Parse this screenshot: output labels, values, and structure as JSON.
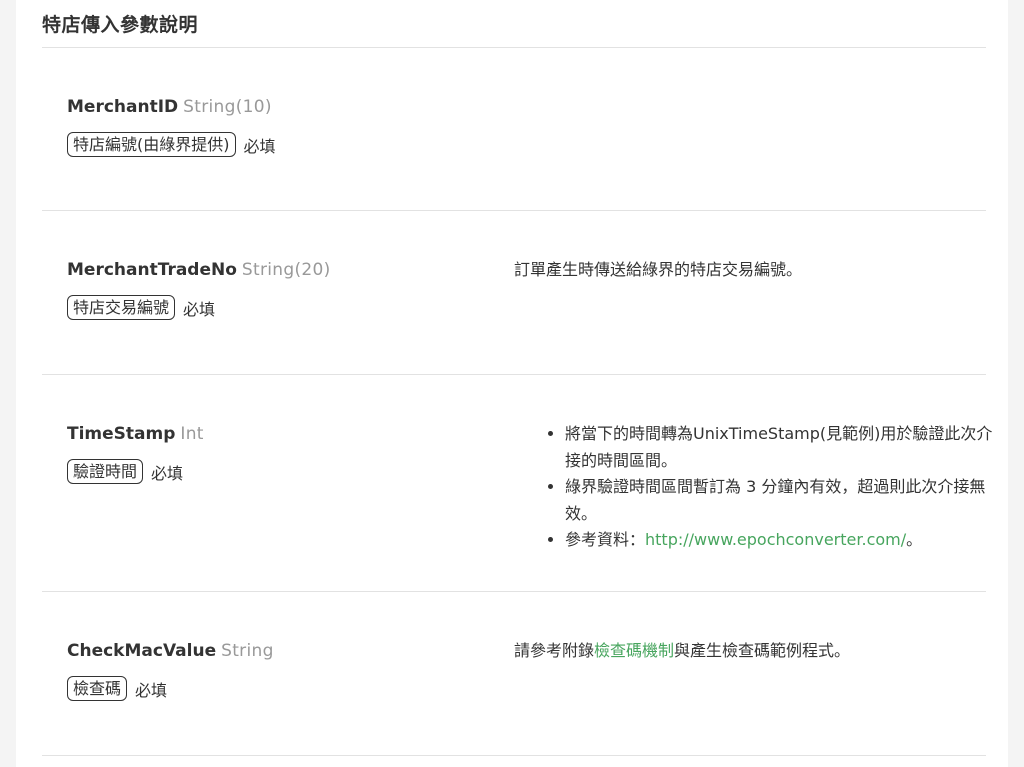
{
  "section": {
    "title": "特店傳入參數說明"
  },
  "params": [
    {
      "name": "MerchantID",
      "type": "String(10)",
      "tag": "特店編號(由綠界提供)",
      "required": "必填"
    },
    {
      "name": "MerchantTradeNo",
      "type": "String(20)",
      "tag": "特店交易編號",
      "required": "必填",
      "description": "訂單產生時傳送給綠界的特店交易編號。"
    },
    {
      "name": "TimeStamp",
      "type": "Int",
      "tag": "驗證時間",
      "required": "必填",
      "bullets": [
        "將當下的時間轉為UnixTimeStamp(見範例)用於驗證此次介接的時間區間。",
        "綠界驗證時間區間暫訂為 3 分鐘內有效，超過則此次介接無效。"
      ],
      "reference": {
        "label": "參考資料：",
        "link": "http://www.epochconverter.com/",
        "suffix": "。"
      }
    },
    {
      "name": "CheckMacValue",
      "type": "String",
      "tag": "檢查碼",
      "required": "必填",
      "description_prefix": "請參考附錄",
      "description_link": "檢查碼機制",
      "description_suffix": "與產生檢查碼範例程式。"
    }
  ],
  "colors": {
    "link": "#47a55e",
    "type_text": "#999999",
    "divider": "#e2e2e2"
  }
}
